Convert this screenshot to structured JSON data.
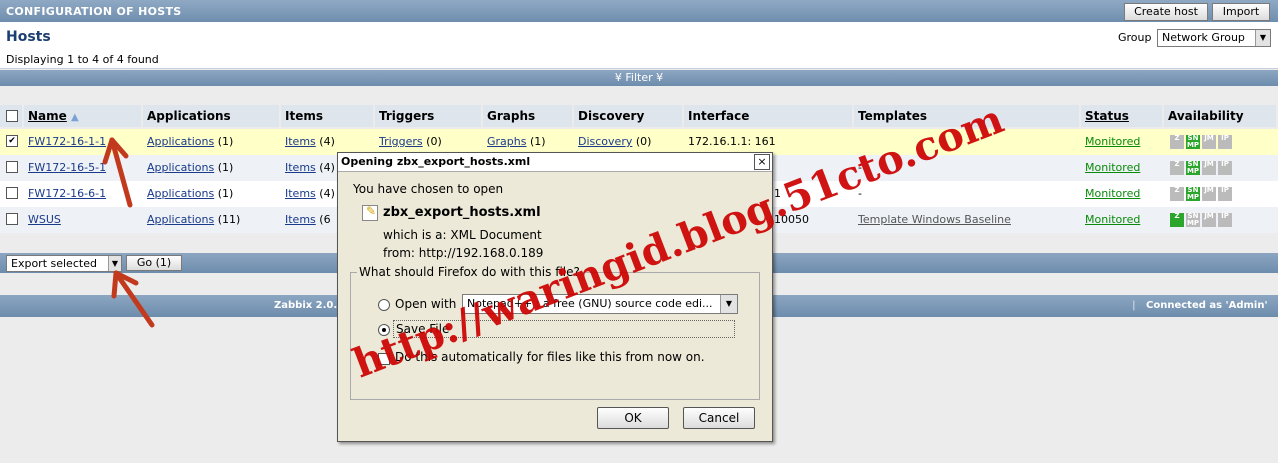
{
  "header": {
    "title": "CONFIGURATION OF HOSTS",
    "create_host": "Create host",
    "import": "Import"
  },
  "hosts_panel": {
    "title": "Hosts",
    "displaying_prefix": "Displaying",
    "from": "1",
    "to_word": "to",
    "to": "4",
    "of_word": "of",
    "total": "4",
    "found_word": "found",
    "group_label": "Group",
    "group_value": "Network Group"
  },
  "filter": {
    "label": "Filter"
  },
  "table": {
    "columns": [
      "Name",
      "Applications",
      "Items",
      "Triggers",
      "Graphs",
      "Discovery",
      "Interface",
      "Templates",
      "Status",
      "Availability"
    ],
    "rows": [
      {
        "checked": true,
        "name": "FW172-16-1-1",
        "applications": "Applications",
        "applications_count": "(1)",
        "items": "Items",
        "items_count": "(4)",
        "triggers": "Triggers",
        "triggers_count": "(0)",
        "graphs": "Graphs",
        "graphs_count": "(1)",
        "discovery": "Discovery",
        "discovery_count": "(0)",
        "interface": "172.16.1.1: 161",
        "templates": "",
        "status": "Monitored"
      },
      {
        "checked": false,
        "name": "FW172-16-5-1",
        "applications": "Applications",
        "applications_count": "(1)",
        "items": "Items",
        "items_count": "(4)",
        "triggers": "",
        "triggers_count": "",
        "graphs": "",
        "graphs_count": "",
        "discovery": "",
        "discovery_count": "",
        "interface": "",
        "templates": "-",
        "status": "Monitored"
      },
      {
        "checked": false,
        "name": "FW172-16-6-1",
        "applications": "Applications",
        "applications_count": "(1)",
        "items": "Items",
        "items_count": "(4)",
        "triggers": "",
        "triggers_count": "",
        "graphs": "",
        "graphs_count": "",
        "discovery": "",
        "discovery_count": "",
        "interface": "1",
        "templates": "-",
        "status": "Monitored"
      },
      {
        "checked": false,
        "name": "WSUS",
        "applications": "Applications",
        "applications_count": "(11)",
        "items": "Items",
        "items_count": "(6",
        "triggers": "",
        "triggers_count": "",
        "graphs": "",
        "graphs_count": "",
        "discovery": "",
        "discovery_count": "",
        "interface": "10050",
        "templates": "Template Windows Baseline",
        "status": "Monitored"
      }
    ]
  },
  "bottom": {
    "export_value": "Export selected",
    "go_label": "Go (1)"
  },
  "footer": {
    "left": "Zabbix 2.0.",
    "right": "Connected as 'Admin'"
  },
  "dialog": {
    "title": "Opening zbx_export_hosts.xml",
    "intro": "You have chosen to open",
    "filename": "zbx_export_hosts.xml",
    "which_is_label": "which is a:",
    "which_is_value": "XML Document",
    "from_label": "from:",
    "from_value": "http://192.168.0.189",
    "question": "What should Firefox do with this file?",
    "open_with": "Open with",
    "open_with_app": "Notepad++ : a free (GNU) source code edi...",
    "save_file": "Save File",
    "auto": "Do this automatically for files like this from now on.",
    "ok": "OK",
    "cancel": "Cancel"
  },
  "watermark": {
    "text": "http://waringid.blog.51cto.com"
  },
  "colors": {
    "header_blue": "#7d99b8",
    "title_blue": "#1c3f73",
    "link_blue": "#1a3a8a",
    "monitored_green": "#0a8a0a",
    "highlight_row": "#ffffc8",
    "watermark_red": "#cc0000"
  }
}
